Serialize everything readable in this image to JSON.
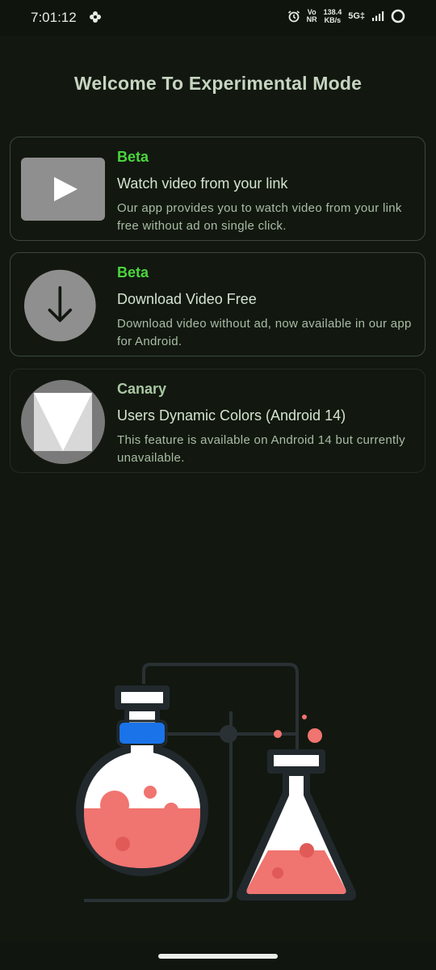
{
  "status_bar": {
    "time": "7:01:12",
    "speed_value": "138.4",
    "speed_unit": "KB/s",
    "volte_top": "Vo",
    "volte_bottom": "NR",
    "network": "5G‡",
    "icons": [
      "pinwheel-icon",
      "alarm-icon",
      "signal-icon",
      "battery-ring-icon"
    ]
  },
  "page": {
    "title": "Welcome To Experimental Mode"
  },
  "features": [
    {
      "tag": "Beta",
      "title": "Watch video from your link",
      "description": "Our app provides you to watch video from your link free without ad on single click.",
      "icon": "play-icon"
    },
    {
      "tag": "Beta",
      "title": "Download Video Free",
      "description": "Download video without ad, now available in our app for Android.",
      "icon": "download-arrow-icon"
    },
    {
      "tag": "Canary",
      "title": "Users Dynamic Colors (Android 14)",
      "description": "This feature is available on Android 14 but currently unavailable.",
      "icon": "android14-logo-icon"
    }
  ],
  "colors": {
    "background": "#121810",
    "beta_tag": "#4cd43e",
    "canary_tag": "#a9c7a2",
    "liquid": "#f07470",
    "flask_cap": "#1a73e8"
  }
}
